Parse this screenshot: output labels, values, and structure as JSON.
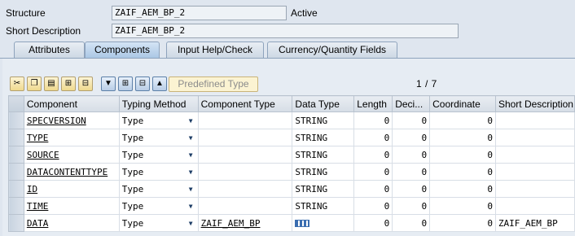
{
  "form": {
    "structure_label": "Structure",
    "structure_value": "ZAIF_AEM_BP_2",
    "status": "Active",
    "short_desc_label": "Short Description",
    "short_desc_value": "ZAIF_AEM_BP_2"
  },
  "tabs": [
    {
      "label": "Attributes",
      "active": false
    },
    {
      "label": "Components",
      "active": true
    },
    {
      "label": "Input Help/Check",
      "active": false
    },
    {
      "label": "Currency/Quantity Fields",
      "active": false
    }
  ],
  "toolbar": {
    "icons": [
      "cut-icon",
      "copy-icon",
      "paste-icon",
      "insert-row-icon",
      "delete-row-icon",
      "filter-icon",
      "expand-icon",
      "collapse-icon",
      "scroll-up-icon"
    ],
    "predefined_type_label": "Predefined Type",
    "pager": "1 / 7"
  },
  "table": {
    "columns": [
      "Component",
      "Typing Method",
      "Component Type",
      "Data Type",
      "Length",
      "Deci...",
      "Coordinate",
      "Short Description"
    ],
    "rows": [
      {
        "component": "SPECVERSION",
        "typing_method": "Type",
        "component_type": "",
        "data_type": "STRING",
        "length": "0",
        "decimals": "0",
        "coordinate": "0",
        "short_description": ""
      },
      {
        "component": "TYPE",
        "typing_method": "Type",
        "component_type": "",
        "data_type": "STRING",
        "length": "0",
        "decimals": "0",
        "coordinate": "0",
        "short_description": ""
      },
      {
        "component": "SOURCE",
        "typing_method": "Type",
        "component_type": "",
        "data_type": "STRING",
        "length": "0",
        "decimals": "0",
        "coordinate": "0",
        "short_description": ""
      },
      {
        "component": "DATACONTENTTYPE",
        "typing_method": "Type",
        "component_type": "",
        "data_type": "STRING",
        "length": "0",
        "decimals": "0",
        "coordinate": "0",
        "short_description": ""
      },
      {
        "component": "ID",
        "typing_method": "Type",
        "component_type": "",
        "data_type": "STRING",
        "length": "0",
        "decimals": "0",
        "coordinate": "0",
        "short_description": ""
      },
      {
        "component": "TIME",
        "typing_method": "Type",
        "component_type": "",
        "data_type": "STRING",
        "length": "0",
        "decimals": "0",
        "coordinate": "0",
        "short_description": ""
      },
      {
        "component": "DATA",
        "typing_method": "Type",
        "component_type": "ZAIF_AEM_BP",
        "data_type": "",
        "data_type_icon": "table-type-icon",
        "length": "0",
        "decimals": "0",
        "coordinate": "0",
        "short_description": "ZAIF_AEM_BP"
      }
    ]
  }
}
